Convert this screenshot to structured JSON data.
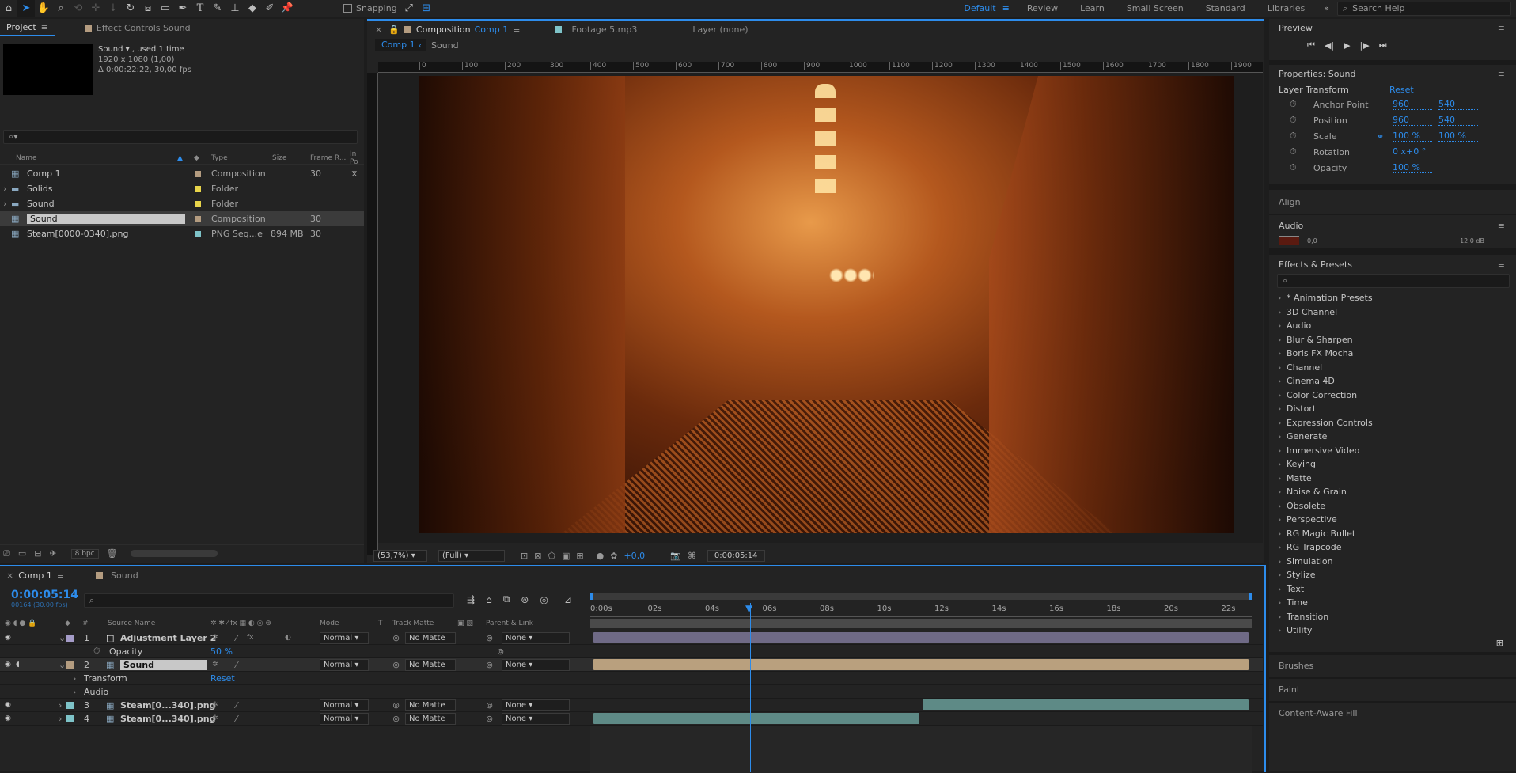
{
  "toolbar": {
    "snapping": "Snapping",
    "workspaces": [
      "Default",
      "Review",
      "Learn",
      "Small Screen",
      "Standard",
      "Libraries"
    ],
    "search_placeholder": "Search Help"
  },
  "project": {
    "tab_project": "Project",
    "tab_effect": "Effect Controls Sound",
    "info_name": "Sound ▾ , used 1 time",
    "info_size": "1920 x 1080 (1,00)",
    "info_dur": "Δ 0:00:22:22, 30,00 fps",
    "columns": {
      "name": "Name",
      "type": "Type",
      "size": "Size",
      "frame": "Frame R...",
      "inpoint": "In Po"
    },
    "items": [
      {
        "name": "Comp 1",
        "type": "Composition",
        "size": "",
        "fps": "30",
        "color": "#b49c80"
      },
      {
        "name": "Solids",
        "type": "Folder",
        "size": "",
        "fps": "",
        "color": "#e8d44a"
      },
      {
        "name": "Sound",
        "type": "Folder",
        "size": "",
        "fps": "",
        "color": "#e8d44a"
      },
      {
        "name": "Sound",
        "type": "Composition",
        "size": "",
        "fps": "30",
        "color": "#b49c80"
      },
      {
        "name": "Steam[0000-0340].png",
        "type": "PNG Seq...e",
        "size": "894 MB",
        "fps": "30",
        "color": "#7ec3c8"
      }
    ],
    "bpc": "8 bpc"
  },
  "comp": {
    "tab_title": "Composition",
    "tab_name": "Comp 1",
    "footage_tab": "Footage 5.mp3",
    "layer_tab": "Layer (none)",
    "breadcrumb": [
      "Comp 1",
      "Sound"
    ],
    "ruler": [
      "0",
      "100",
      "200",
      "300",
      "400",
      "500",
      "600",
      "700",
      "800",
      "900",
      "1000",
      "1100",
      "1200",
      "1300",
      "1400",
      "1500",
      "1600",
      "1700",
      "1800",
      "1900"
    ],
    "zoom": "(53,7%)",
    "resolution": "(Full)",
    "exposure": "+0,0",
    "timecode": "0:00:05:14"
  },
  "right": {
    "preview": "Preview",
    "properties_title": "Properties: Sound",
    "layer_transform": "Layer Transform",
    "reset": "Reset",
    "props": [
      {
        "label": "Anchor Point",
        "v1": "960",
        "v2": "540"
      },
      {
        "label": "Position",
        "v1": "960",
        "v2": "540"
      },
      {
        "label": "Scale",
        "v1": "100 %",
        "v2": "100 %"
      },
      {
        "label": "Rotation",
        "v1": "0 x+0 °",
        "v2": ""
      },
      {
        "label": "Opacity",
        "v1": "100 %",
        "v2": ""
      }
    ],
    "align": "Align",
    "audio": "Audio",
    "audio_left": "0,0",
    "audio_right": "12,0 dB",
    "effects_title": "Effects & Presets",
    "effects": [
      "* Animation Presets",
      "3D Channel",
      "Audio",
      "Blur & Sharpen",
      "Boris FX Mocha",
      "Channel",
      "Cinema 4D",
      "Color Correction",
      "Distort",
      "Expression Controls",
      "Generate",
      "Immersive Video",
      "Keying",
      "Matte",
      "Noise & Grain",
      "Obsolete",
      "Perspective",
      "RG Magic Bullet",
      "RG Trapcode",
      "Simulation",
      "Stylize",
      "Text",
      "Time",
      "Transition",
      "Utility"
    ],
    "brushes": "Brushes",
    "paint": "Paint",
    "content_aware": "Content-Aware Fill"
  },
  "timeline": {
    "tab1": "Comp 1",
    "tab2": "Sound",
    "timecode": "0:00:05:14",
    "frames": "00164 (30.00 fps)",
    "columns": {
      "hash": "#",
      "source": "Source Name",
      "mode": "Mode",
      "t": "T",
      "track": "Track Matte",
      "parent": "Parent & Link"
    },
    "ruler": [
      "0:00s",
      "02s",
      "04s",
      "06s",
      "08s",
      "10s",
      "12s",
      "14s",
      "16s",
      "18s",
      "20s",
      "22s"
    ],
    "layers": [
      {
        "num": "1",
        "name": "Adjustment Layer 2",
        "mode": "Normal",
        "matte": "No Matte",
        "parent": "None",
        "color": "#a59cc8"
      },
      {
        "num": "2",
        "name": "Sound",
        "mode": "Normal",
        "matte": "No Matte",
        "parent": "None",
        "color": "#b49c80"
      },
      {
        "num": "3",
        "name": "Steam[0...340].png",
        "mode": "Normal",
        "matte": "No Matte",
        "parent": "None",
        "color": "#7ec3c8"
      },
      {
        "num": "4",
        "name": "Steam[0...340].png",
        "mode": "Normal",
        "matte": "No Matte",
        "parent": "None",
        "color": "#7ec3c8"
      }
    ],
    "opacity_label": "Opacity",
    "opacity_value": "50 %",
    "transform_label": "Transform",
    "transform_reset": "Reset",
    "audio_label": "Audio"
  }
}
